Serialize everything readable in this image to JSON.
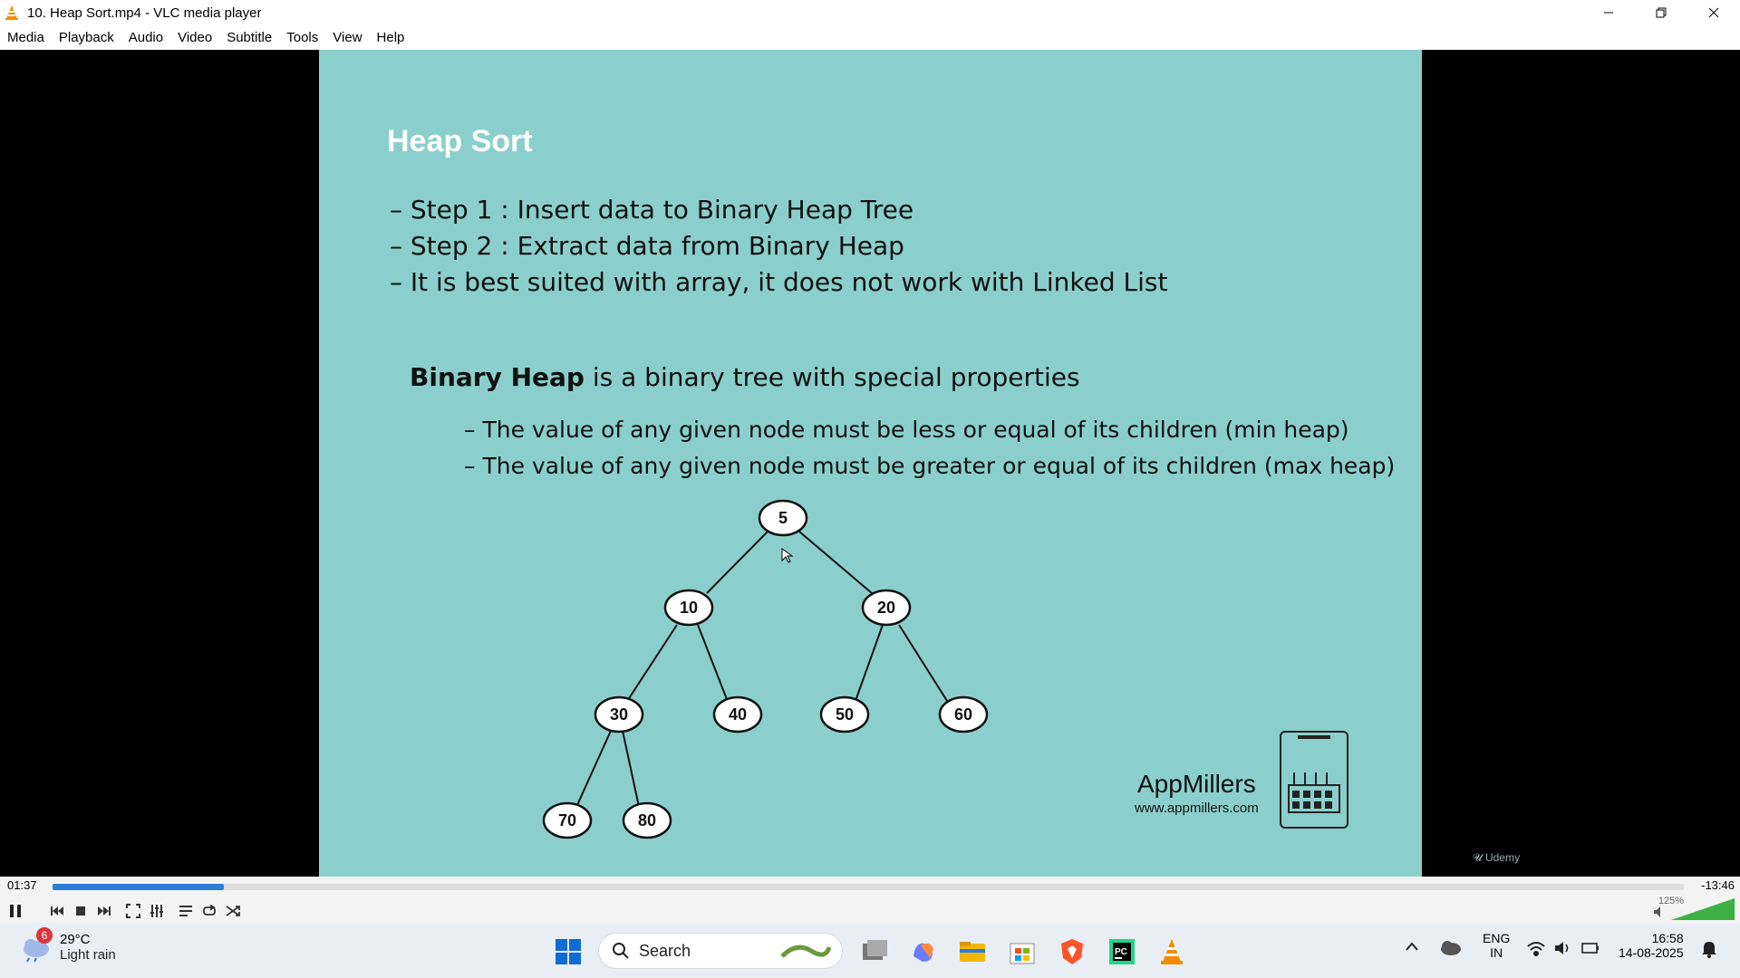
{
  "window": {
    "title": "10. Heap Sort.mp4 - VLC media player",
    "brand_color": "#f48b00"
  },
  "menu": [
    "Media",
    "Playback",
    "Audio",
    "Video",
    "Subtitle",
    "Tools",
    "View",
    "Help"
  ],
  "slide": {
    "title": "Heap Sort",
    "steps": [
      "– Step 1 : Insert data to Binary Heap Tree",
      "– Step 2 : Extract data from Binary Heap",
      "– It is best suited with array, it does not work with Linked List"
    ],
    "heap_bold": "Binary Heap",
    "heap_rest": " is a binary tree with special properties",
    "properties": [
      "– The value of any given node must be less or equal of its children (min heap)",
      "– The value of any given node must be greater or equal of its children (max heap)"
    ],
    "tree_nodes": [
      "5",
      "10",
      "20",
      "30",
      "40",
      "50",
      "60",
      "70",
      "80"
    ],
    "brand_name": "AppMillers",
    "brand_url": "www.appmillers.com",
    "watermark": "Udemy",
    "bg_color": "#8acfcc"
  },
  "player": {
    "elapsed": "01:37",
    "remaining": "-13:46",
    "progress_percent": 10.5,
    "volume_label": "125%"
  },
  "taskbar": {
    "weather_badge": "6",
    "temperature": "29°C",
    "condition": "Light rain",
    "search_label": "Search",
    "lang_top": "ENG",
    "lang_bottom": "IN",
    "clock_time": "16:58",
    "clock_date": "14-08-2025"
  }
}
